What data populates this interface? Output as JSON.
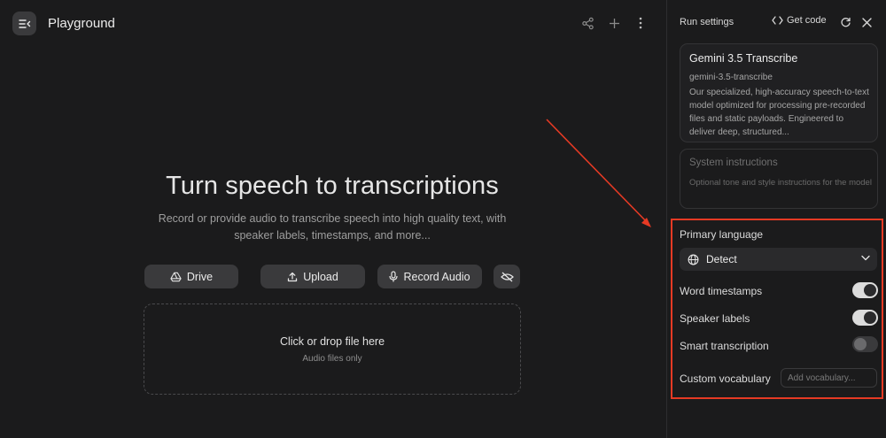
{
  "header": {
    "title": "Playground",
    "icons": [
      "menu-collapse-icon",
      "share-icon",
      "plus-icon",
      "more-vert-icon"
    ]
  },
  "main": {
    "heading": "Turn speech to transcriptions",
    "subheading": "Record or provide audio to transcribe speech into high quality text, with speaker labels, timestamps, and more...",
    "buttons": {
      "drive": "Drive",
      "upload": "Upload",
      "record": "Record Audio"
    },
    "dropzone": {
      "title": "Click or drop file here",
      "hint": "Audio files only"
    }
  },
  "panel": {
    "title": "Run settings",
    "get_code": "Get code",
    "model": {
      "name": "Gemini 3.5 Transcribe",
      "id": "gemini-3.5-transcribe",
      "description": "Our specialized, high-accuracy speech-to-text model optimized for processing pre-recorded files and static payloads. Engineered to deliver deep, structured..."
    },
    "system_instructions": {
      "title": "System instructions",
      "placeholder": "Optional tone and style instructions for the model"
    },
    "primary_language": {
      "label": "Primary language",
      "value": "Detect"
    },
    "word_timestamps": {
      "label": "Word timestamps",
      "enabled": true
    },
    "speaker_labels": {
      "label": "Speaker labels",
      "enabled": true
    },
    "smart_transcription": {
      "label": "Smart transcription",
      "enabled": false
    },
    "custom_vocabulary": {
      "label": "Custom vocabulary",
      "placeholder": "Add vocabulary..."
    }
  },
  "colors": {
    "background": "#1b1b1c",
    "button": "#3a3a3c",
    "highlight_annotation": "#e63a24"
  }
}
